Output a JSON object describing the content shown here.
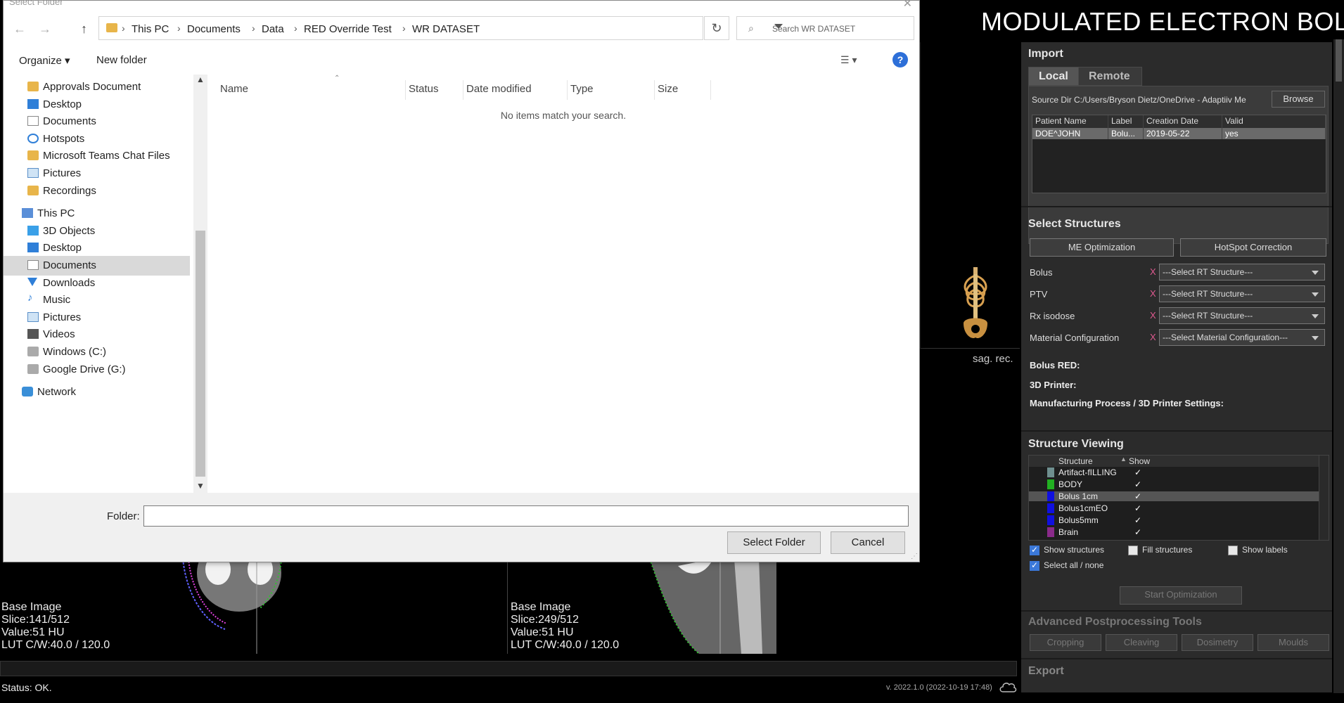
{
  "app": {
    "title": "MODULATED ELECTRON BOLUS",
    "sag_label": "sag. rec.",
    "status": "Status: OK.",
    "version": "v. 2022.1.0 (2022-10-19 17:48)"
  },
  "ct_views": [
    {
      "label": "Base Image",
      "slice": "Slice:141/512",
      "value": "Value:51 HU",
      "lut": "LUT C/W:40.0 / 120.0"
    },
    {
      "label": "Base Image",
      "slice": "Slice:249/512",
      "value": "Value:51 HU",
      "lut": "LUT C/W:40.0 / 120.0"
    }
  ],
  "import": {
    "title": "Import",
    "tabs": [
      "Local",
      "Remote"
    ],
    "source_dir_label": "Source Dir  C:/Users/Bryson Dietz/OneDrive - Adaptiiv Me",
    "browse": "Browse",
    "columns": [
      "Patient Name",
      "Label",
      "Creation Date",
      "Valid"
    ],
    "rows": [
      [
        "DOE^JOHN",
        "Bolu...",
        "2019-05-22",
        "yes"
      ]
    ]
  },
  "structures": {
    "title": "Select Structures",
    "me_optimization": "ME Optimization",
    "hotspot_correction": "HotSpot Correction",
    "rows": [
      {
        "label": "Bolus",
        "x": "X",
        "value": "---Select RT Structure---"
      },
      {
        "label": "PTV",
        "x": "X",
        "value": "---Select RT Structure---"
      },
      {
        "label": "Rx isodose",
        "x": "X",
        "value": "---Select RT Structure---"
      },
      {
        "label": "Material Configuration",
        "x": "X",
        "value": "---Select Material Configuration---"
      }
    ],
    "bolus_red": "Bolus RED:",
    "printer": "3D Printer:",
    "manufacturing": "Manufacturing Process / 3D Printer Settings:"
  },
  "viewing": {
    "title": "Structure Viewing",
    "col_structure": "Structure",
    "col_show": "Show",
    "items": [
      {
        "name": "Artifact-fILLING",
        "color": "#6f8f8f",
        "check": "✓"
      },
      {
        "name": "BODY",
        "color": "#22b022",
        "check": "✓"
      },
      {
        "name": "Bolus 1cm",
        "color": "#1010e0",
        "check": "✓"
      },
      {
        "name": "Bolus1cmEO",
        "color": "#1010e0",
        "check": "✓"
      },
      {
        "name": "Bolus5mm",
        "color": "#1010e0",
        "check": "✓"
      },
      {
        "name": "Brain",
        "color": "#8a2a8a",
        "check": "✓"
      }
    ],
    "show_structures": "Show structures",
    "fill_structures": "Fill structures",
    "show_labels": "Show labels",
    "select_all": "Select all / none",
    "start_optimization": "Start Optimization"
  },
  "advanced": {
    "title": "Advanced Postprocessing Tools",
    "buttons": [
      "Cropping",
      "Cleaving",
      "Dosimetry",
      "Moulds"
    ]
  },
  "export": {
    "title": "Export"
  },
  "dialog": {
    "title": "Select Folder",
    "close": "✕",
    "back": "←",
    "forward": "→",
    "up": "↑",
    "breadcrumb": [
      "This PC",
      "Documents",
      "Data",
      "RED Override Test",
      "WR DATASET"
    ],
    "search_placeholder": "Search WR DATASET",
    "organize": "Organize ▾",
    "new_folder": "New folder",
    "help": "?",
    "nav_items": [
      {
        "label": "Approvals Document",
        "icon": "folder-icon"
      },
      {
        "label": "Desktop",
        "icon": "desktop-icon"
      },
      {
        "label": "Documents",
        "icon": "documents-icon"
      },
      {
        "label": "Hotspots",
        "icon": "hotspots-icon"
      },
      {
        "label": "Microsoft Teams Chat Files",
        "icon": "folder-icon"
      },
      {
        "label": "Pictures",
        "icon": "pictures-icon"
      },
      {
        "label": "Recordings",
        "icon": "folder-icon"
      },
      {
        "label": "This PC",
        "icon": "pc-icon"
      },
      {
        "label": "3D Objects",
        "icon": "3d-objects-icon"
      },
      {
        "label": "Desktop",
        "icon": "desktop-icon"
      },
      {
        "label": "Documents",
        "icon": "documents-icon"
      },
      {
        "label": "Downloads",
        "icon": "downloads-icon"
      },
      {
        "label": "Music",
        "icon": "music-icon"
      },
      {
        "label": "Pictures",
        "icon": "pictures-icon"
      },
      {
        "label": "Videos",
        "icon": "videos-icon"
      },
      {
        "label": "Windows  (C:)",
        "icon": "drive-icon"
      },
      {
        "label": "Google Drive (G:)",
        "icon": "drive-icon"
      },
      {
        "label": "Network",
        "icon": "network-icon"
      }
    ],
    "columns": [
      "Name",
      "Status",
      "Date modified",
      "Type",
      "Size"
    ],
    "empty_message": "No items match your search.",
    "folder_label": "Folder:",
    "folder_value": "",
    "select_folder": "Select Folder",
    "cancel": "Cancel"
  }
}
